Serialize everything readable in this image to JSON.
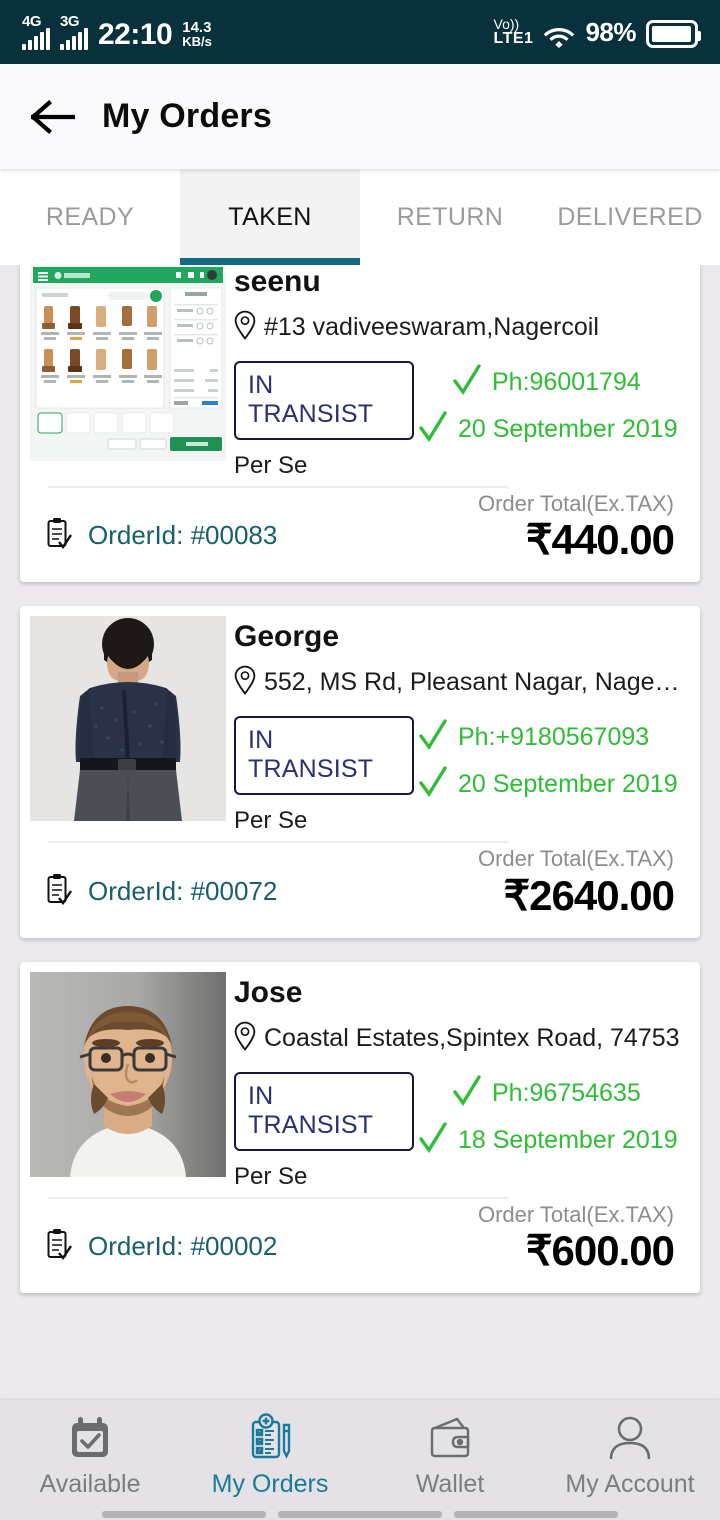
{
  "statusbar": {
    "net1_label": "4G",
    "net2_label": "3G",
    "time": "22:10",
    "speed_value": "14.3",
    "speed_unit": "KB/s",
    "volte_top": "Vo))",
    "volte_bottom": "LTE1",
    "battery_percent": "98%",
    "icons": {
      "wifi": "wifi-icon",
      "battery": "battery-icon",
      "signal": "signal-bars-icon"
    }
  },
  "appbar": {
    "back_icon": "back-arrow-icon",
    "title": "My Orders"
  },
  "tabs": [
    {
      "label": "READY",
      "active": false
    },
    {
      "label": "TAKEN",
      "active": true
    },
    {
      "label": "RETURN",
      "active": false
    },
    {
      "label": "DELIVERED",
      "active": false
    }
  ],
  "colors": {
    "status_bar_bg": "#08313c",
    "accent_teal": "#16697f",
    "verify_green": "#2fbd35",
    "badge_text": "#2b2f73",
    "order_id_text": "#17606b",
    "page_bg": "#eceaee",
    "nav_active": "#1a7a99"
  },
  "orders": [
    {
      "customer": "seenu",
      "address": "#13 vadiveeswaram,Nagercoil",
      "status": "IN TRANSIST",
      "payment": "Per Se",
      "phone": "Ph:96001794",
      "date": "20 September 2019",
      "order_id_label": "OrderId: #00083",
      "total_label": "Order Total(Ex.TAX)",
      "total_amount": "₹440.00",
      "thumb_kind": "pos"
    },
    {
      "customer": "George",
      "address": "552, MS Rd, Pleasant Nagar, Nagerc…",
      "status": "IN TRANSIST",
      "payment": "Per Se",
      "phone": "Ph:+9180567093",
      "date": "20 September 2019",
      "order_id_label": "OrderId: #00072",
      "total_label": "Order Total(Ex.TAX)",
      "total_amount": "₹2640.00",
      "thumb_kind": "man-shirt"
    },
    {
      "customer": "Jose",
      "address": "Coastal Estates,Spintex Road, 74753",
      "status": "IN TRANSIST",
      "payment": "Per Se",
      "phone": "Ph:96754635",
      "date": "18 September 2019",
      "order_id_label": "OrderId: #00002",
      "total_label": "Order Total(Ex.TAX)",
      "total_amount": "₹600.00",
      "thumb_kind": "portrait"
    }
  ],
  "bottomnav": [
    {
      "label": "Available",
      "icon": "calendar-check-icon",
      "active": false
    },
    {
      "label": "My Orders",
      "icon": "clipboard-checklist-pencil-icon",
      "active": true
    },
    {
      "label": "Wallet",
      "icon": "wallet-icon",
      "active": false
    },
    {
      "label": "My Account",
      "icon": "person-icon",
      "active": false
    }
  ]
}
